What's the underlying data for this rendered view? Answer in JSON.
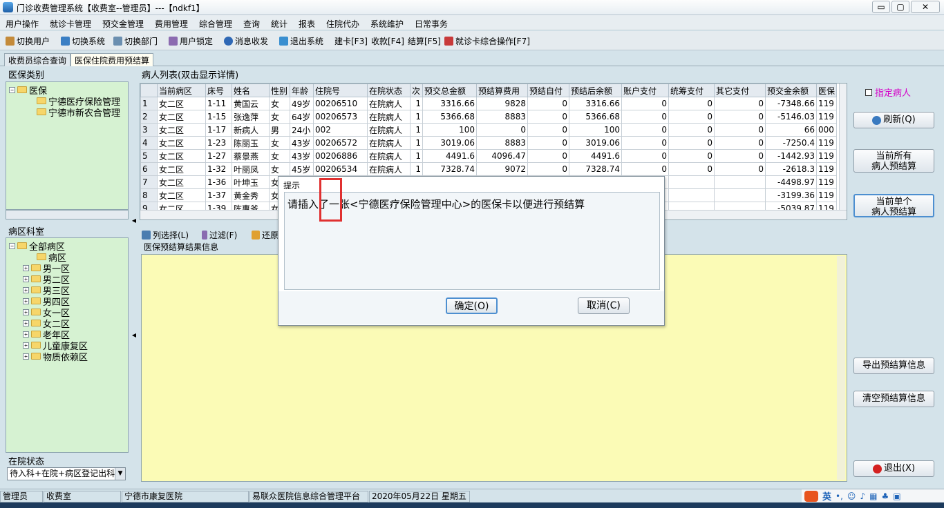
{
  "window": {
    "title": "门诊收费管理系统【收费室--管理员】---【ndkf1】",
    "min": "▭",
    "max": "▢",
    "close": "✕"
  },
  "menu": [
    "用户操作",
    "就诊卡管理",
    "预交金管理",
    "费用管理",
    "综合管理",
    "查询",
    "统计",
    "报表",
    "住院代办",
    "系统维护",
    "日常事务"
  ],
  "toolbar": [
    "切换用户",
    "切换系统",
    "切换部门",
    "用户锁定",
    "消息收发",
    "退出系统",
    "建卡[F3]",
    "收款[F4]",
    "结算[F5]",
    "就诊卡综合操作[F7]"
  ],
  "tabs": [
    "收费员综合查询",
    "医保住院费用预结算"
  ],
  "insurance_panel": {
    "title": "医保类别",
    "root": "医保",
    "children": [
      "宁德医疗保险管理",
      "宁德市新农合管理"
    ]
  },
  "ward_panel": {
    "title": "病区科室",
    "root": "全部病区",
    "children": [
      "病区",
      "男一区",
      "男二区",
      "男三区",
      "男四区",
      "女一区",
      "女二区",
      "老年区",
      "儿童康复区",
      "物质依赖区"
    ]
  },
  "status_panel": {
    "title": "在院状态",
    "value": "待入科+在院+病区登记出科"
  },
  "patient_list": {
    "title": "病人列表(双击显示详情)",
    "columns": [
      "",
      "当前病区",
      "床号",
      "姓名",
      "性别",
      "年龄",
      "住院号",
      "在院状态",
      "次",
      "预交总金额",
      "预结算费用",
      "预结自付",
      "预结后余额",
      "账户支付",
      "统筹支付",
      "其它支付",
      "预交金余额",
      "医保"
    ],
    "rows": [
      [
        "1",
        "女二区",
        "1-11",
        "黄国云",
        "女",
        "49岁",
        "00206510",
        "在院病人",
        "1",
        "3316.66",
        "9828",
        "0",
        "3316.66",
        "0",
        "0",
        "0",
        "-7348.66",
        "119"
      ],
      [
        "2",
        "女二区",
        "1-15",
        "张逸萍",
        "女",
        "64岁",
        "00206573",
        "在院病人",
        "1",
        "5366.68",
        "8883",
        "0",
        "5366.68",
        "0",
        "0",
        "0",
        "-5146.03",
        "119"
      ],
      [
        "3",
        "女二区",
        "1-17",
        "新病人",
        "男",
        "24小",
        "002",
        "在院病人",
        "1",
        "100",
        "0",
        "0",
        "100",
        "0",
        "0",
        "0",
        "66",
        "000"
      ],
      [
        "4",
        "女二区",
        "1-23",
        "陈丽玉",
        "女",
        "43岁",
        "00206572",
        "在院病人",
        "1",
        "3019.06",
        "8883",
        "0",
        "3019.06",
        "0",
        "0",
        "0",
        "-7250.4",
        "119"
      ],
      [
        "5",
        "女二区",
        "1-27",
        "蔡景燕",
        "女",
        "43岁",
        "00206886",
        "在院病人",
        "1",
        "4491.6",
        "4096.47",
        "0",
        "4491.6",
        "0",
        "0",
        "0",
        "-1442.93",
        "119"
      ],
      [
        "6",
        "女二区",
        "1-32",
        "叶丽凤",
        "女",
        "45岁",
        "00206534",
        "在院病人",
        "1",
        "7328.74",
        "9072",
        "0",
        "7328.74",
        "0",
        "0",
        "0",
        "-2618.3",
        "119"
      ],
      [
        "7",
        "女二区",
        "1-36",
        "叶坤玉",
        "女",
        "",
        "",
        "",
        "",
        "",
        "",
        "",
        "",
        "",
        "",
        "",
        "-4498.97",
        "119"
      ],
      [
        "8",
        "女二区",
        "1-37",
        "黄金秀",
        "女",
        "",
        "",
        "",
        "",
        "",
        "",
        "",
        "",
        "",
        "",
        "",
        "-3199.36",
        "119"
      ],
      [
        "9",
        "女二区",
        "1-39",
        "陈惠爷",
        "女",
        "",
        "",
        "",
        "",
        "",
        "",
        "",
        "",
        "",
        "",
        "",
        "-5039.87",
        "119"
      ]
    ]
  },
  "filter_bar": {
    "columns": "列选择(L)",
    "filter": "过滤(F)",
    "restore": "还原"
  },
  "result": {
    "title": "医保预结算结果信息"
  },
  "right": {
    "designate": "指定病人",
    "refresh": "刷新(Q)",
    "all_line1": "当前所有",
    "all_line2": "病人预结算",
    "single_line1": "当前单个",
    "single_line2": "病人预结算",
    "export": "导出预结算信息",
    "clear": "清空预结算信息",
    "exit": "退出(X)"
  },
  "dialog": {
    "title": "提示",
    "message": "请插入了一张<宁德医疗保险管理中心>的医保卡以便进行预结算",
    "ok": "确定(O)",
    "cancel": "取消(C)"
  },
  "status": [
    "管理员",
    "收费室",
    "宁德市康复医院",
    "易联众医院信息综合管理平台",
    "2020年05月22日 星期五"
  ],
  "ime": {
    "lang": "英"
  },
  "colors": {
    "tree_bg": "#d6f2d2",
    "result_bg": "#fbfbb6",
    "accent_pink": "#d400c8",
    "highlight_box": "#e03030"
  }
}
